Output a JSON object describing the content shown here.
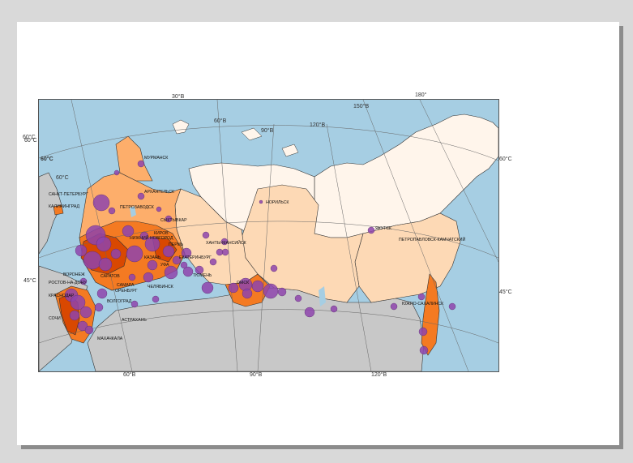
{
  "colors": {
    "sea": "#a6cee3",
    "neighbor_land": "#c8c8c8",
    "level1": "#fff5eb",
    "level2": "#fdd9b5",
    "level3": "#fdae6b",
    "level4": "#f47a22",
    "level5": "#d94801",
    "bubble": "#8e44ad"
  },
  "graticule": {
    "top": [
      "30°В",
      "60°В",
      "90°В",
      "120°В",
      "150°В",
      "180°"
    ],
    "bottom": [
      "60°В",
      "90°В",
      "120°В"
    ],
    "left": [
      "60°С",
      "60°С",
      "60°С",
      "45°С"
    ],
    "right": [
      "60°С",
      "45°С"
    ]
  },
  "cities": [
    {
      "name": "МУРМАНСК"
    },
    {
      "name": "САНКТ-ПЕТЕРБУРГ"
    },
    {
      "name": "АРХАНГЕЛЬСК"
    },
    {
      "name": "КАЛИНИНГРАД"
    },
    {
      "name": "ПЕТРОЗАВОДСК"
    },
    {
      "name": "СЫКТЫВКАР"
    },
    {
      "name": "НОРИЛЬСК"
    },
    {
      "name": "ЯКУТСК"
    },
    {
      "name": "КИРОВ"
    },
    {
      "name": "НИЖНИЙ НОВГОРОД"
    },
    {
      "name": "ПЕРМЬ"
    },
    {
      "name": "ХАНТЫ-МАНСИЙСК"
    },
    {
      "name": "ПЕТРОПАВЛОВСК-КАМЧАТСКИЙ"
    },
    {
      "name": "КАЗАНЬ"
    },
    {
      "name": "ЕКАТЕРИНБУРГ"
    },
    {
      "name": "УФА"
    },
    {
      "name": "ВОРОНЕЖ"
    },
    {
      "name": "САРАТОВ"
    },
    {
      "name": "ТЮМЕНЬ"
    },
    {
      "name": "РОСТОВ-НА-ДОНУ"
    },
    {
      "name": "САМАРА"
    },
    {
      "name": "ЧЕЛЯБИНСК"
    },
    {
      "name": "ОМСК"
    },
    {
      "name": "ОРЕНБУРГ"
    },
    {
      "name": "КРАСНОДАР"
    },
    {
      "name": "ВОЛГОГРАД"
    },
    {
      "name": "ЮЖНО-САХАЛИНСК"
    },
    {
      "name": "СОЧИ"
    },
    {
      "name": "АСТРАХАНЬ"
    },
    {
      "name": "МАХАЧКАЛА"
    }
  ]
}
